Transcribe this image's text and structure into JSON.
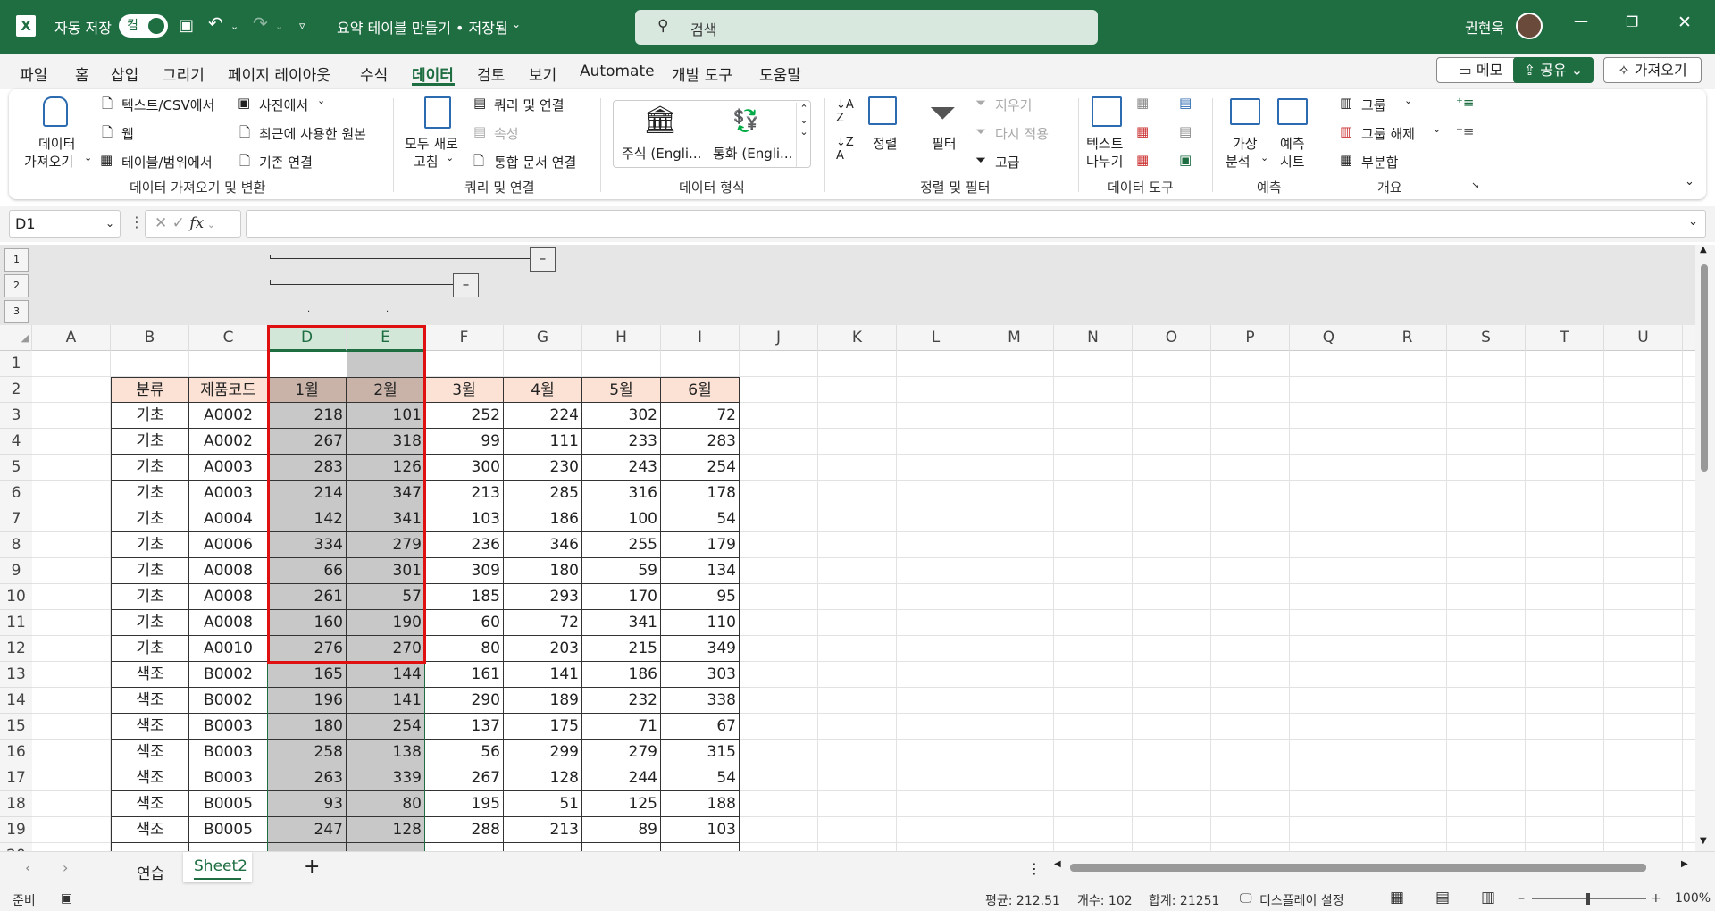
{
  "app": {
    "autosave_label": "자동 저장",
    "autosave_state": "켬",
    "doc_title": "요약 테이블 만들기 • 저장됨",
    "search_placeholder": "검색",
    "user": "권현욱"
  },
  "menu": [
    "파일",
    "홈",
    "삽입",
    "그리기",
    "페이지 레이아웃",
    "수식",
    "데이터",
    "검토",
    "보기",
    "Automate",
    "개발 도구",
    "도움말"
  ],
  "active_menu": "데이터",
  "top_buttons": {
    "memo": "메모",
    "share": "공유",
    "get": "가져오기"
  },
  "ribbon": {
    "get_data": [
      "데이터",
      "가져오기"
    ],
    "from_text": "텍스트/CSV에서",
    "web": "웹",
    "from_table": "테이블/범위에서",
    "from_picture": "사진에서",
    "recent": "최근에 사용한 원본",
    "existing": "기존 연결",
    "group1": "데이터 가져오기 및 변환",
    "refresh_all": [
      "모두 새로",
      "고침"
    ],
    "queries": "쿼리 및 연결",
    "properties": "속성",
    "edit_links": "통합 문서 연결",
    "group2": "쿼리 및 연결",
    "stocks": "주식 (Engli...",
    "currency": "통화 (Engli...",
    "group3": "데이터 형식",
    "sort": "정렬",
    "filter": "필터",
    "clear": "지우기",
    "reapply": "다시 적용",
    "advanced": "고급",
    "group4": "정렬 및 필터",
    "text_to_col": [
      "텍스트",
      "나누기"
    ],
    "group5": "데이터 도구",
    "whatif": [
      "가상",
      "분석"
    ],
    "forecast": [
      "예측",
      "시트"
    ],
    "group6": "예측",
    "group_btn": "그룹",
    "ungroup": "그룹 해제",
    "subtotal": "부분합",
    "group7": "개요"
  },
  "namebox": "D1",
  "outline_levels": [
    "1",
    "2",
    "3"
  ],
  "columns": [
    "A",
    "B",
    "C",
    "D",
    "E",
    "F",
    "G",
    "H",
    "I",
    "J",
    "K",
    "L",
    "M",
    "N",
    "O",
    "P",
    "Q",
    "R",
    "S",
    "T",
    "U"
  ],
  "table": {
    "headers": [
      "분류",
      "제품코드",
      "1월",
      "2월",
      "3월",
      "4월",
      "5월",
      "6월"
    ],
    "rows": [
      [
        "기초",
        "A0002",
        "218",
        "101",
        "252",
        "224",
        "302",
        "72"
      ],
      [
        "기초",
        "A0002",
        "267",
        "318",
        "99",
        "111",
        "233",
        "283"
      ],
      [
        "기초",
        "A0003",
        "283",
        "126",
        "300",
        "230",
        "243",
        "254"
      ],
      [
        "기초",
        "A0003",
        "214",
        "347",
        "213",
        "285",
        "316",
        "178"
      ],
      [
        "기초",
        "A0004",
        "142",
        "341",
        "103",
        "186",
        "100",
        "54"
      ],
      [
        "기초",
        "A0006",
        "334",
        "279",
        "236",
        "346",
        "255",
        "179"
      ],
      [
        "기초",
        "A0008",
        "66",
        "301",
        "309",
        "180",
        "59",
        "134"
      ],
      [
        "기초",
        "A0008",
        "261",
        "57",
        "185",
        "293",
        "170",
        "95"
      ],
      [
        "기초",
        "A0008",
        "160",
        "190",
        "60",
        "72",
        "341",
        "110"
      ],
      [
        "기초",
        "A0010",
        "276",
        "270",
        "80",
        "203",
        "215",
        "349"
      ],
      [
        "색조",
        "B0002",
        "165",
        "144",
        "161",
        "141",
        "186",
        "303"
      ],
      [
        "색조",
        "B0002",
        "196",
        "141",
        "290",
        "189",
        "232",
        "338"
      ],
      [
        "색조",
        "B0003",
        "180",
        "254",
        "137",
        "175",
        "71",
        "67"
      ],
      [
        "색조",
        "B0003",
        "258",
        "138",
        "56",
        "299",
        "279",
        "315"
      ],
      [
        "색조",
        "B0003",
        "263",
        "339",
        "267",
        "128",
        "244",
        "54"
      ],
      [
        "색조",
        "B0005",
        "93",
        "80",
        "195",
        "51",
        "125",
        "188"
      ],
      [
        "색조",
        "B0005",
        "247",
        "128",
        "288",
        "213",
        "89",
        "103"
      ]
    ]
  },
  "sheets": [
    "연습",
    "Sheet2"
  ],
  "active_sheet": "Sheet2",
  "status": {
    "ready": "준비",
    "average": "평균: 212.51",
    "count": "개수: 102",
    "sum": "합계: 21251",
    "display": "디스플레이 설정",
    "zoom": "100%"
  },
  "colors": {
    "title_green": "#1e6e42",
    "header_fill": "#fbe2d5",
    "selection": "#c8c8c8",
    "highlight_red": "#e01010"
  }
}
